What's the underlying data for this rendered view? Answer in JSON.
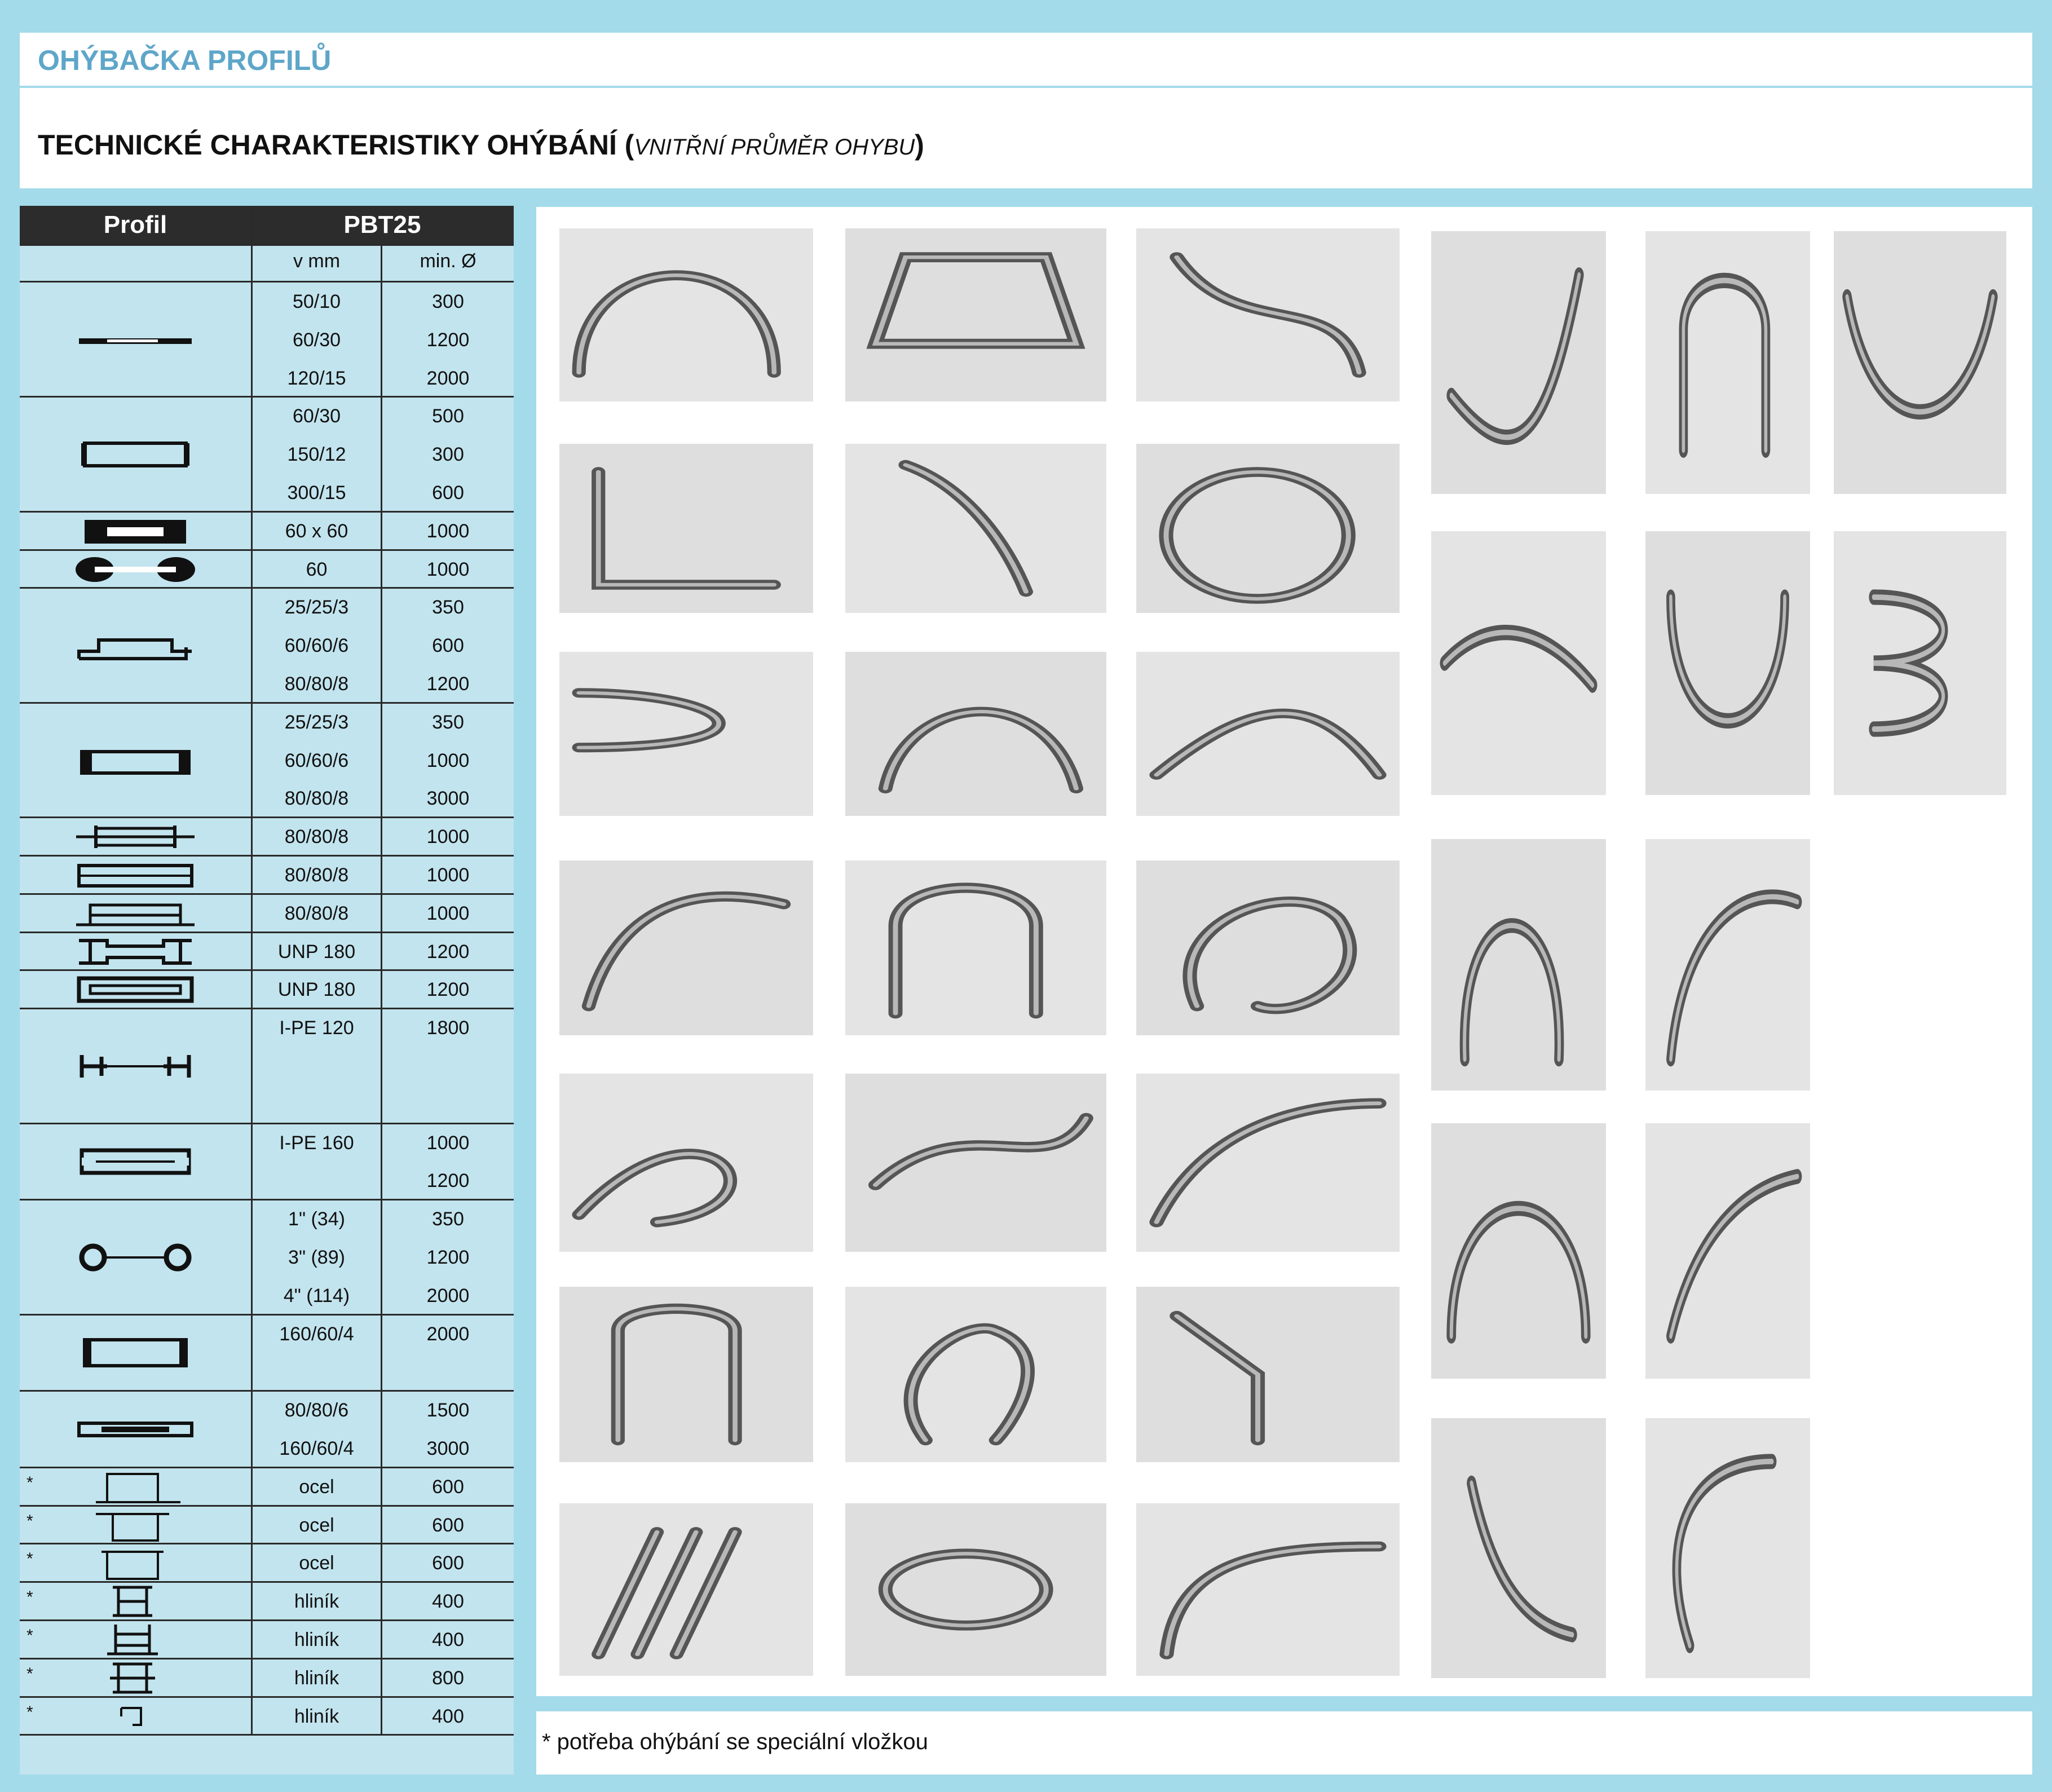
{
  "header": {
    "brand": "OHÝBAČKA PROFILŮ",
    "title_main": "TECHNICKÉ CHARAKTERISTIKY OHÝBÁNÍ (",
    "title_sub": "VNITŘNÍ PRŮMĚR OHYBU",
    "title_end": ")"
  },
  "table": {
    "col_profile": "Profil",
    "col_model": "PBT25",
    "sub_mm": "v mm",
    "sub_min": "min. Ø",
    "rows": [
      {
        "shape": "flat-bar",
        "entries": [
          [
            "50/10",
            "300"
          ],
          [
            "60/30",
            "1200"
          ],
          [
            "120/15",
            "2000"
          ]
        ]
      },
      {
        "shape": "flat-bar-upright",
        "entries": [
          [
            "60/30",
            "500"
          ],
          [
            "150/12",
            "300"
          ],
          [
            "300/15",
            "600"
          ]
        ]
      },
      {
        "shape": "square",
        "entries": [
          [
            "60 x 60",
            "1000"
          ]
        ]
      },
      {
        "shape": "round",
        "entries": [
          [
            "60",
            "1000"
          ]
        ]
      },
      {
        "shape": "angle",
        "entries": [
          [
            "25/25/3",
            "350"
          ],
          [
            "60/60/6",
            "600"
          ],
          [
            "80/80/8",
            "1200"
          ]
        ]
      },
      {
        "shape": "angle-upright",
        "entries": [
          [
            "25/25/3",
            "350"
          ],
          [
            "60/60/6",
            "1000"
          ],
          [
            "80/80/8",
            "3000"
          ]
        ]
      },
      {
        "shape": "tee-1",
        "entries": [
          [
            "80/80/8",
            "1000"
          ]
        ]
      },
      {
        "shape": "tee-2",
        "entries": [
          [
            "80/80/8",
            "1000"
          ]
        ]
      },
      {
        "shape": "tee-3",
        "entries": [
          [
            "80/80/8",
            "1000"
          ]
        ]
      },
      {
        "shape": "channel",
        "entries": [
          [
            "UNP 180",
            "1200"
          ]
        ]
      },
      {
        "shape": "channel-upright",
        "entries": [
          [
            "UNP 180",
            "1200"
          ]
        ]
      },
      {
        "shape": "i-beam",
        "entries": [
          [
            "I-PE 120",
            "1800"
          ]
        ]
      },
      {
        "shape": "i-beam-upright",
        "entries": [
          [
            "I-PE 160",
            "1000"
          ],
          [
            "",
            "1200"
          ]
        ]
      },
      {
        "shape": "tube",
        "entries": [
          [
            "1\" (34)",
            "350"
          ],
          [
            "3\" (89)",
            "1200"
          ],
          [
            "4\" (114)",
            "2000"
          ]
        ]
      },
      {
        "shape": "rect-tube",
        "entries": [
          [
            "160/60/4",
            "2000"
          ]
        ]
      },
      {
        "shape": "rect-tube-upright",
        "entries": [
          [
            "80/80/6",
            "1500"
          ],
          [
            "160/60/4",
            "3000"
          ]
        ]
      },
      {
        "shape": "special-1",
        "star": "*",
        "entries": [
          [
            "ocel",
            "600"
          ]
        ]
      },
      {
        "shape": "special-2",
        "star": "*",
        "entries": [
          [
            "ocel",
            "600"
          ]
        ]
      },
      {
        "shape": "special-3",
        "star": "*",
        "entries": [
          [
            "ocel",
            "600"
          ]
        ]
      },
      {
        "shape": "alu-1",
        "star": "*",
        "entries": [
          [
            "hliník",
            "400"
          ]
        ]
      },
      {
        "shape": "alu-2",
        "star": "*",
        "entries": [
          [
            "hliník",
            "400"
          ]
        ]
      },
      {
        "shape": "alu-3",
        "star": "*",
        "entries": [
          [
            "hliník",
            "800"
          ]
        ]
      },
      {
        "shape": "alu-4",
        "star": "*",
        "entries": [
          [
            "hliník",
            "400"
          ]
        ]
      }
    ]
  },
  "gallery": {
    "photos": [
      "bent-rods",
      "bent-rect-frame",
      "s-curve-tube",
      "angle-bend",
      "curved-channel",
      "ring",
      "hairpin-tube",
      "curved-flat-bar",
      "curved-profiles",
      "curved-strip",
      "tube-frame",
      "wavy-ring",
      "twisted-tube",
      "twisted-flat",
      "curved-rail",
      "arch-stand",
      "organic-loop",
      "triple-bend",
      "perforated-profiles",
      "coiled-tube",
      "curved-rail-2",
      "perforated-bend",
      "arched-window",
      "nested-bends",
      "gentle-curve",
      "u-bent-strip",
      "helix-coil",
      "arch-rod",
      "curved-extrusion",
      "semicircle-rod",
      "studded-bend",
      "blue-strip-bend",
      "loop-extrusion",
      "wavy-extrusion",
      "wood-grain-bend",
      "j-bend-profile"
    ]
  },
  "footnote": "* potřeba ohýbání se speciální vložkou",
  "colors": {
    "background": "#a3dbea",
    "table_bg": "#c2e4ee",
    "header_dark": "#2c2c2c",
    "brand": "#5ea6c9"
  }
}
